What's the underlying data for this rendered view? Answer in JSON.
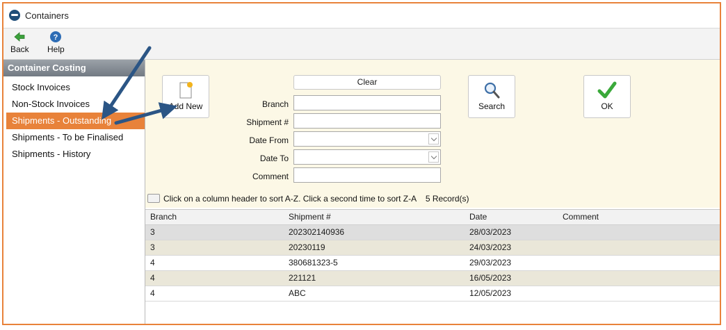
{
  "window": {
    "title": "Containers"
  },
  "toolbar": {
    "back_label": "Back",
    "help_label": "Help"
  },
  "sidebar": {
    "header": "Container Costing",
    "items": [
      {
        "label": "Stock Invoices",
        "active": false
      },
      {
        "label": "Non-Stock Invoices",
        "active": false
      },
      {
        "label": "Shipments - Outstanding",
        "active": true
      },
      {
        "label": "Shipments - To be Finalised",
        "active": false
      },
      {
        "label": "Shipments - History",
        "active": false
      }
    ]
  },
  "filters": {
    "add_new_label": "Add New",
    "clear_label": "Clear",
    "search_label": "Search",
    "ok_label": "OK",
    "branch_label": "Branch",
    "branch_value": "",
    "shipment_label": "Shipment #",
    "shipment_value": "",
    "date_from_label": "Date From",
    "date_from_value": "",
    "date_to_label": "Date To",
    "date_to_value": "",
    "comment_label": "Comment",
    "comment_value": ""
  },
  "grid": {
    "sort_hint": "Click on a column header to sort A-Z. Click a second time to sort Z-A",
    "record_count": "5 Record(s)",
    "columns": [
      "Branch",
      "Shipment #",
      "Date",
      "Comment"
    ],
    "rows": [
      [
        "3",
        "202302140936",
        "28/03/2023",
        ""
      ],
      [
        "3",
        "20230119",
        "24/03/2023",
        ""
      ],
      [
        "4",
        "380681323-5",
        "29/03/2023",
        ""
      ],
      [
        "4",
        "221121",
        "16/05/2023",
        ""
      ],
      [
        "4",
        "ABC",
        "12/05/2023",
        ""
      ]
    ]
  },
  "colors": {
    "accent": "#e8823a",
    "panel": "#fcf8e6",
    "arrow": "#2b5585",
    "ok_check": "#3aa93a",
    "back_arrow": "#3ca13c",
    "help_icon": "#2e6db5"
  }
}
